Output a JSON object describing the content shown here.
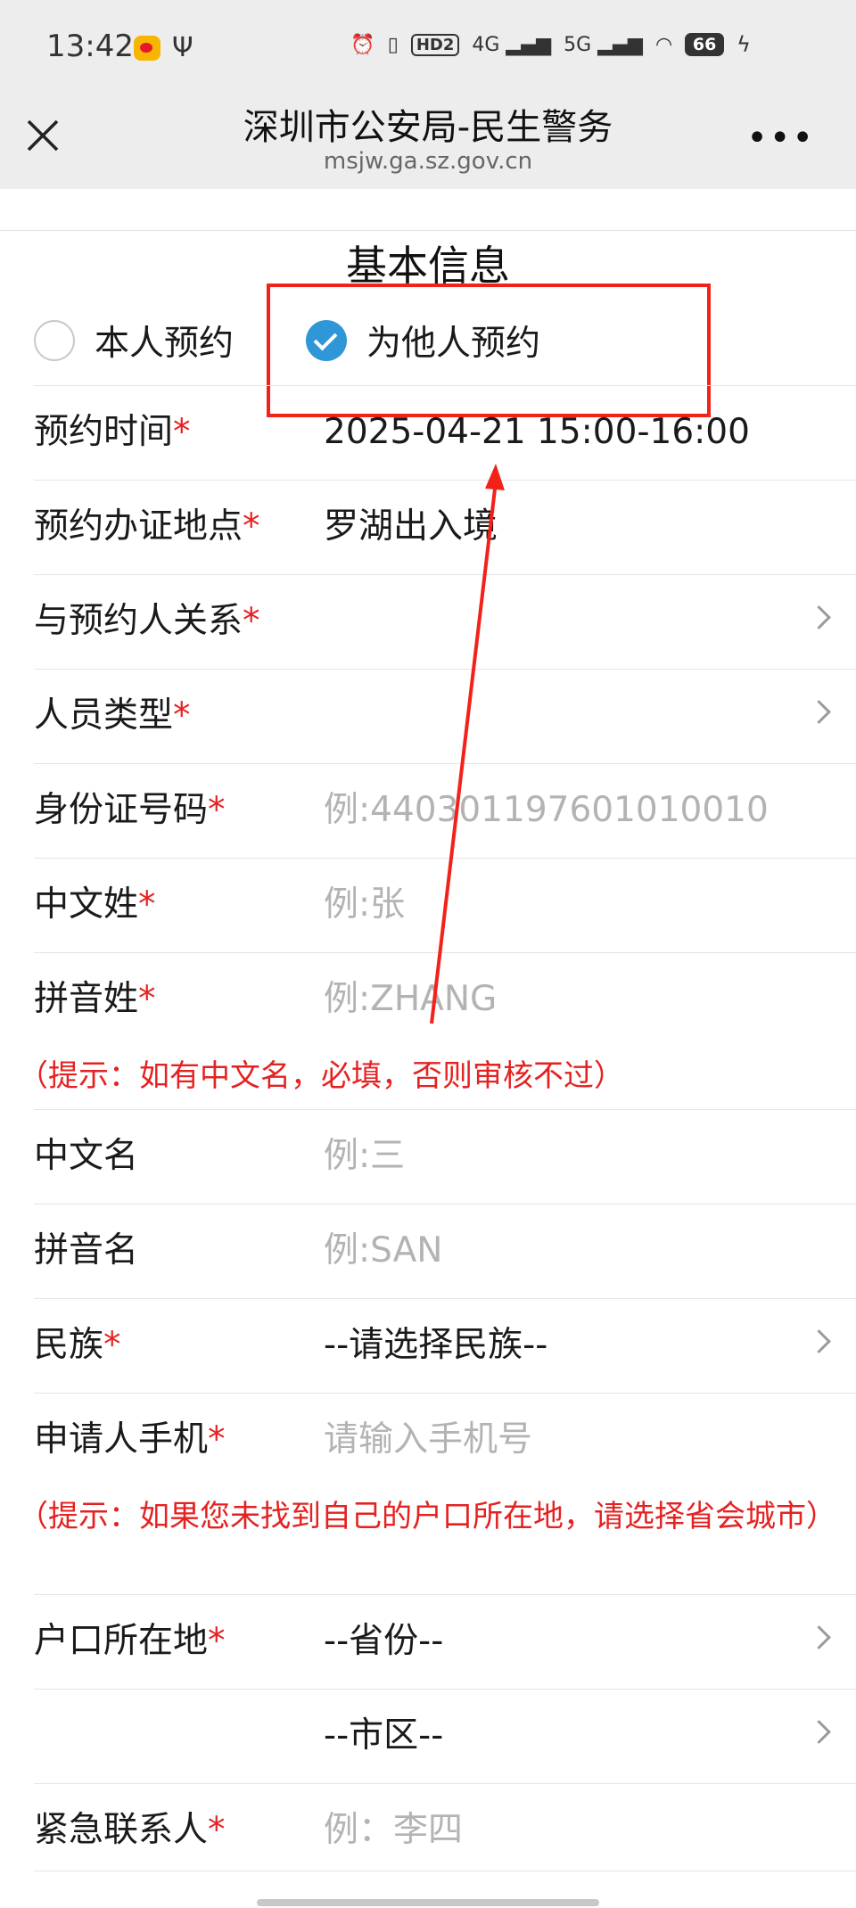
{
  "status": {
    "time": "13:42",
    "icons": [
      "weibo-icon",
      "usb-icon",
      "alarm-icon",
      "vibrate-icon",
      "hd-icon",
      "4g-signal-icon",
      "5g-signal-icon",
      "wifi-icon",
      "battery-icon",
      "charging-icon"
    ],
    "hd": "HD2",
    "net1": "4G",
    "net2": "5G",
    "battery": "66"
  },
  "header": {
    "title": "深圳市公安局-民生警务",
    "url": "msjw.ga.sz.gov.cn"
  },
  "section_title": "基本信息",
  "booking_type": {
    "self_label": "本人预约",
    "other_label": "为他人预约",
    "selected": "other"
  },
  "required_mark": "*",
  "form": {
    "appt_time": {
      "label": "预约时间",
      "value": "2025-04-21 15:00-16:00"
    },
    "location": {
      "label": "预约办证地点",
      "value": "罗湖出入境"
    },
    "relation": {
      "label": "与预约人关系"
    },
    "person_type": {
      "label": "人员类型"
    },
    "id_number": {
      "label": "身份证号码",
      "placeholder": "例:440301197601010010"
    },
    "surname_cn": {
      "label": "中文姓",
      "placeholder": "例:张"
    },
    "surname_py": {
      "label": "拼音姓",
      "placeholder": "例:ZHANG"
    },
    "tip1": "（提示：如有中文名，必填，否则审核不过）",
    "given_cn": {
      "label": "中文名",
      "placeholder": "例:三"
    },
    "given_py": {
      "label": "拼音名",
      "placeholder": "例:SAN"
    },
    "ethnicity": {
      "label": "民族",
      "value": "--请选择民族--"
    },
    "mobile": {
      "label": "申请人手机",
      "placeholder": "请输入手机号"
    },
    "tip2": "（提示：如果您未找到自己的户口所在地，请选择省会城市）",
    "household": {
      "label": "户口所在地",
      "province": "--省份--",
      "city": "--市区--"
    },
    "emergency": {
      "label": "紧急联系人",
      "placeholder": "例：李四"
    }
  },
  "colors": {
    "accent": "#2f96d8",
    "required": "#e52222",
    "annotation": "#f2221a"
  }
}
